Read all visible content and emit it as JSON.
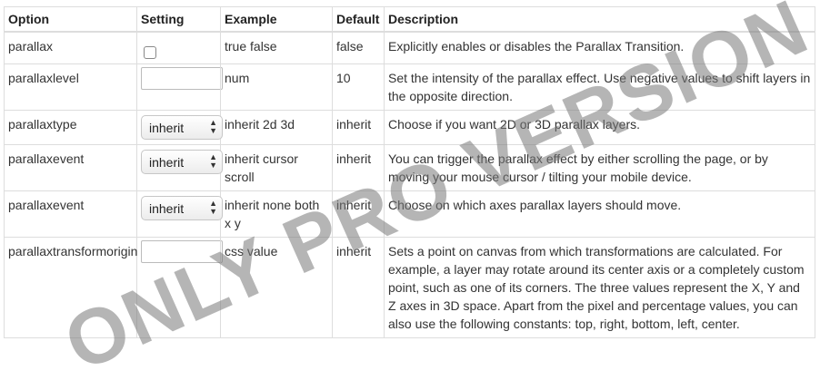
{
  "header": {
    "option": "Option",
    "setting": "Setting",
    "example": "Example",
    "default": "Default",
    "description": "Description"
  },
  "rows": [
    {
      "option": "parallax",
      "setting_type": "checkbox",
      "example": "true false",
      "default": "false",
      "description": "Explicitly enables or disables the Parallax Transition."
    },
    {
      "option": "parallaxlevel",
      "setting_type": "text",
      "setting_value": "",
      "example": "num",
      "default": "10",
      "description": "Set the intensity of the parallax effect. Use negative values to shift layers in the opposite direction."
    },
    {
      "option": "parallaxtype",
      "setting_type": "select",
      "setting_value": "inherit",
      "example": "inherit 2d 3d",
      "default": "inherit",
      "description": "Choose if you want 2D or 3D parallax layers."
    },
    {
      "option": "parallaxevent",
      "setting_type": "select",
      "setting_value": "inherit",
      "example": "inherit cursor scroll",
      "default": "inherit",
      "description": "You can trigger the parallax effect by either scrolling the page, or by moving your mouse cursor / tilting your mobile device."
    },
    {
      "option": "parallaxevent",
      "setting_type": "select",
      "setting_value": "inherit",
      "example": "inherit none both x y",
      "default": "inherit",
      "description": "Choose on which axes parallax layers should move."
    },
    {
      "option": "parallaxtransformorigin",
      "setting_type": "text",
      "setting_value": "",
      "example": "css value",
      "default": "inherit",
      "description": "Sets a point on canvas from which transformations are calculated. For example, a layer may rotate around its center axis or a completely custom point, such as one of its corners. The three values represent the X, Y and Z axes in 3D space. Apart from the pixel and percentage values, you can also use the following constants: top, right, bottom, left, center."
    }
  ],
  "watermark": "ONLY PRO VERSION",
  "select_arrow_icon": "up-down-arrows-icon"
}
